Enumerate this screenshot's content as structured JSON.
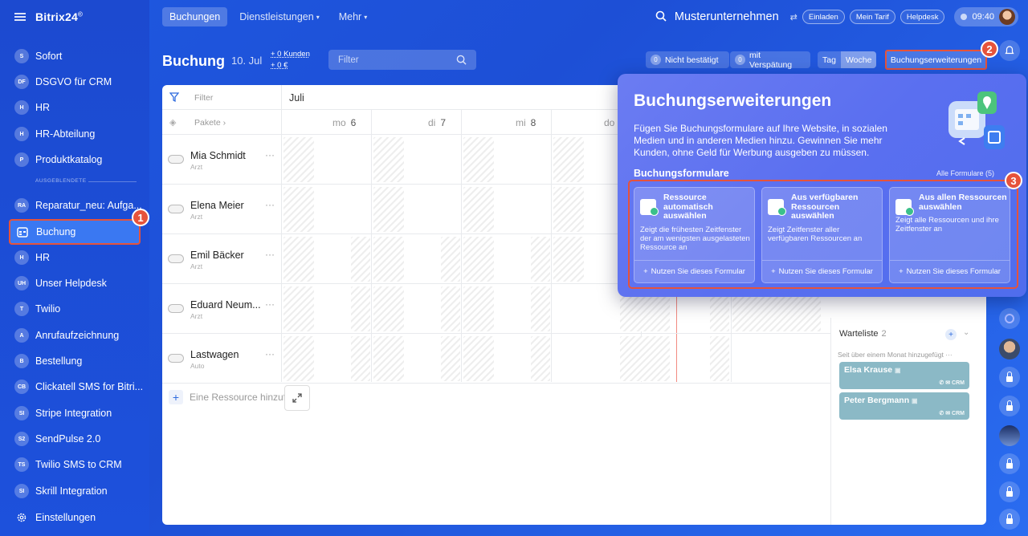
{
  "app": {
    "logo": "Bitrix24",
    "logo_mark": "©"
  },
  "sidebar": {
    "items": [
      {
        "badge": "S",
        "label": "Sofort"
      },
      {
        "badge": "DF",
        "label": "DSGVO für CRM"
      },
      {
        "badge": "H",
        "label": "HR"
      },
      {
        "badge": "H",
        "label": "HR-Abteilung"
      },
      {
        "badge": "P",
        "label": "Produktkatalog"
      }
    ],
    "hidden_label": "AUSGEBLENDETE",
    "hidden_items": [
      {
        "badge": "RA",
        "label": "Reparatur_neu: Aufga..."
      },
      {
        "badge": "",
        "label": "Buchung"
      },
      {
        "badge": "H",
        "label": "HR"
      },
      {
        "badge": "UH",
        "label": "Unser Helpdesk"
      },
      {
        "badge": "T",
        "label": "Twilio"
      },
      {
        "badge": "A",
        "label": "Anrufaufzeichnung"
      },
      {
        "badge": "B",
        "label": "Bestellung"
      },
      {
        "badge": "CB",
        "label": "Clickatell SMS for Bitri..."
      },
      {
        "badge": "SI",
        "label": "Stripe Integration"
      },
      {
        "badge": "S2",
        "label": "SendPulse 2.0"
      },
      {
        "badge": "TS",
        "label": "Twilio SMS to CRM"
      },
      {
        "badge": "SI",
        "label": "Skrill Integration"
      }
    ],
    "settings": "Einstellungen"
  },
  "callouts": [
    "1",
    "2",
    "3"
  ],
  "topbar": {
    "tabs": [
      "Buchungen",
      "Dienstleistungen",
      "Mehr"
    ],
    "company": "Musterunternehmen",
    "invite": "Einladen",
    "tariff": "Mein Tarif",
    "helpdesk": "Helpdesk",
    "time": "09:40"
  },
  "page": {
    "title": "Buchung",
    "date": "10. Jul",
    "stat_customers": "+ 0 Kunden",
    "stat_money": "+ 0 €",
    "filter_placeholder": "Filter",
    "unconfirmed_count": "0",
    "unconfirmed_label": "Nicht bestätigt",
    "delayed_count": "0",
    "delayed_label": "mit Verspätung",
    "view_day": "Tag",
    "view_week": "Woche",
    "extensions_button": "Buchungserweiterungen"
  },
  "calendar": {
    "filter_label": "Filter",
    "packages_label": "Pakete",
    "month": "Juli",
    "days": [
      {
        "name": "mo",
        "num": "6"
      },
      {
        "name": "di",
        "num": "7"
      },
      {
        "name": "mi",
        "num": "8"
      },
      {
        "name": "do",
        "num": ""
      }
    ],
    "resources": [
      {
        "name": "Mia Schmidt",
        "role": "Arzt"
      },
      {
        "name": "Elena Meier",
        "role": "Arzt"
      },
      {
        "name": "Emil Bäcker",
        "role": "Arzt"
      },
      {
        "name": "Eduard Neum...",
        "role": "Arzt"
      },
      {
        "name": "Lastwagen",
        "role": "Auto"
      }
    ],
    "add_resource": "Eine Ressource hinzuf"
  },
  "waitlist": {
    "title": "Warteliste",
    "count": "2",
    "subtitle": "Seit über einem Monat hinzugefügt",
    "cards": [
      {
        "name": "Elsa Krause",
        "crm": "CRM"
      },
      {
        "name": "Peter Bergmann",
        "crm": "CRM"
      }
    ]
  },
  "popup": {
    "title": "Buchungserweiterungen",
    "description": "Fügen Sie Buchungsformulare auf Ihre Website, in sozialen Medien und in anderen Medien hinzu. Gewinnen Sie mehr Kunden, ohne Geld für Werbung ausgeben zu müssen.",
    "section": "Buchungsformulare",
    "all_forms": "Alle Formulare (5)",
    "cards": [
      {
        "title": "Ressource automatisch auswählen",
        "desc": "Zeigt die frühesten Zeitfenster der am wenigsten ausgelasteten Ressource an",
        "button": "Nutzen Sie dieses Formular"
      },
      {
        "title": "Aus verfügbaren Ressourcen auswählen",
        "desc": "Zeigt Zeitfenster aller verfügbaren Ressourcen an",
        "button": "Nutzen Sie dieses Formular"
      },
      {
        "title": "Aus allen Ressourcen auswählen",
        "desc": "Zeigt alle Ressourcen und ihre Zeitfenster an",
        "button": "Nutzen Sie dieses Formular"
      }
    ]
  },
  "colors": {
    "accent": "#1f58e0",
    "callout": "#e6533b",
    "popup": "#5a6ff0",
    "waitlist_card": "#8bb9c6"
  }
}
